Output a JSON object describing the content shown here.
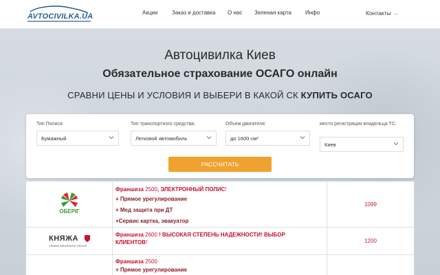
{
  "header": {
    "logo_text": "AVTOCIVILKA.UA",
    "nav": [
      "Акции",
      "Заказ и доставка",
      "О нас",
      "Зеленая карта",
      "Инфо"
    ],
    "contacts_label": "Контакты"
  },
  "hero": {
    "title": "Автоцивилка Киев",
    "subtitle": "Обязательное страхование ОСАГО онлайн",
    "tagline_regular": "СРАВНИ ЦЕНЫ И УСЛОВИЯ И ВЫБЕРИ В КАКОЙ СК ",
    "tagline_bold": "КУПИТЬ ОСАГО"
  },
  "form": {
    "policy_type": {
      "label": "Тип Полиса:",
      "value": "Бумажный"
    },
    "vehicle_type": {
      "label": "Тип транспортного средства:",
      "value": "Легковой автомобиль"
    },
    "engine_volume": {
      "label": "Объем двигателя:",
      "value": "до 1600 см³"
    },
    "registration": {
      "label": "место регистрации владельца ТС:",
      "value": "Киев"
    },
    "calculate_label": "РАССЧИТАТЬ"
  },
  "results": [
    {
      "company_logo_text": "ОБЕРІГ",
      "franchise_label": "Франшиза",
      "franchise_value": "2500",
      "franchise_extra": ", ЭЛЕКТРОННЫЙ ПОЛИС",
      "franchise_excl": "!",
      "features": [
        "+ Прямое урегулирование",
        "+ Мед защита при ДТ",
        "+Сервис картка, эвакуатор"
      ],
      "price": "1099"
    },
    {
      "company_logo_text": "КНЯЖА",
      "company_logo_sub": "VIENNA INSURANCE GROUP",
      "franchise_label": "Франшиза",
      "franchise_value": "2600",
      "franchise_extra": " ! ВЫСОКАЯ СТЕПЕНЬ НАДЕЖНОСТИ! ВЫБОР",
      "franchise_extra2": "КЛИЕНТОВ",
      "franchise_excl": "!",
      "price": "1200"
    },
    {
      "franchise_label": "Франшиза",
      "franchise_value": "2500",
      "features": [
        "+ Прямое урегулирование"
      ]
    }
  ],
  "colors": {
    "accent": "#f0a22e",
    "brand": "#2b5f93",
    "price": "#c8102e"
  }
}
